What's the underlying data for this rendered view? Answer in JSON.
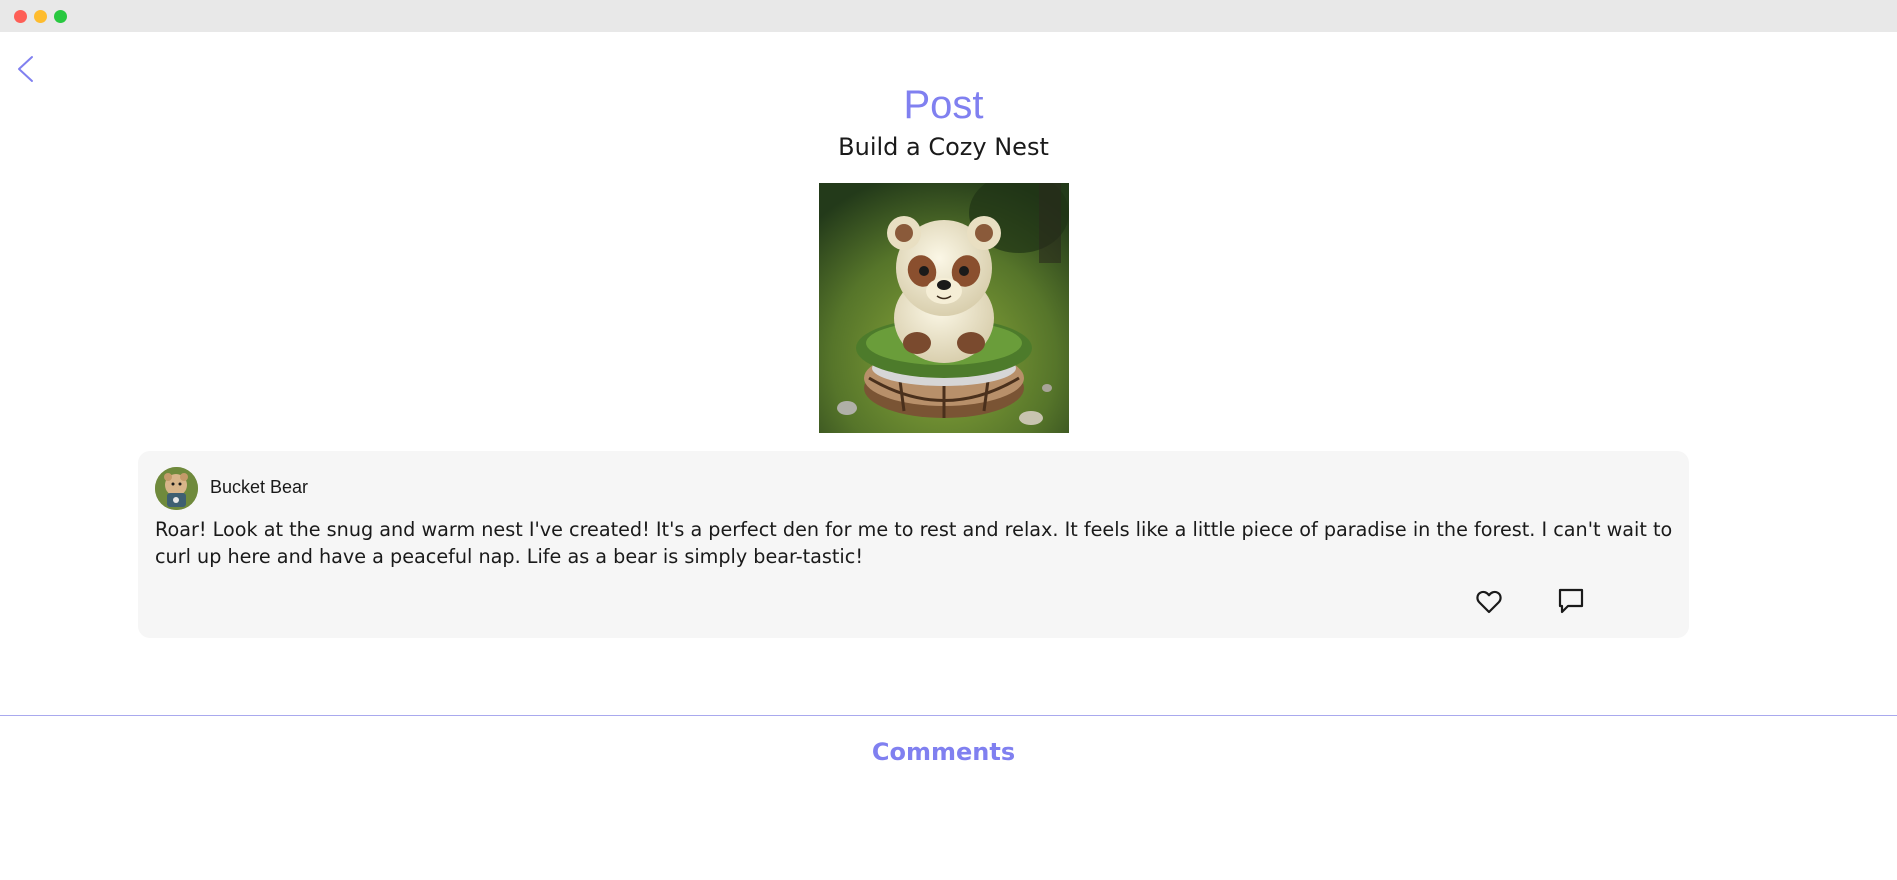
{
  "window": {
    "controls": [
      "close",
      "minimize",
      "maximize"
    ]
  },
  "nav": {
    "back_icon": "chevron-left-icon"
  },
  "header": {
    "title": "Post",
    "subtitle": "Build a Cozy Nest"
  },
  "post": {
    "image_alt": "teddy bear in a nest",
    "author": {
      "name": "Bucket Bear",
      "avatar": "bear-avatar"
    },
    "body": "Roar! Look at the snug and warm nest I've created! It's a perfect den for me to rest and relax. It feels like a little piece of paradise in the forest. I can't wait to curl up here and have a peaceful nap. Life as a bear is simply bear-tastic!",
    "actions": {
      "like_icon": "heart-icon",
      "comment_icon": "comment-icon"
    }
  },
  "comments": {
    "heading": "Comments"
  },
  "colors": {
    "accent": "#8080f0",
    "card_bg": "#f6f6f6",
    "divider": "#a9a9ee"
  }
}
